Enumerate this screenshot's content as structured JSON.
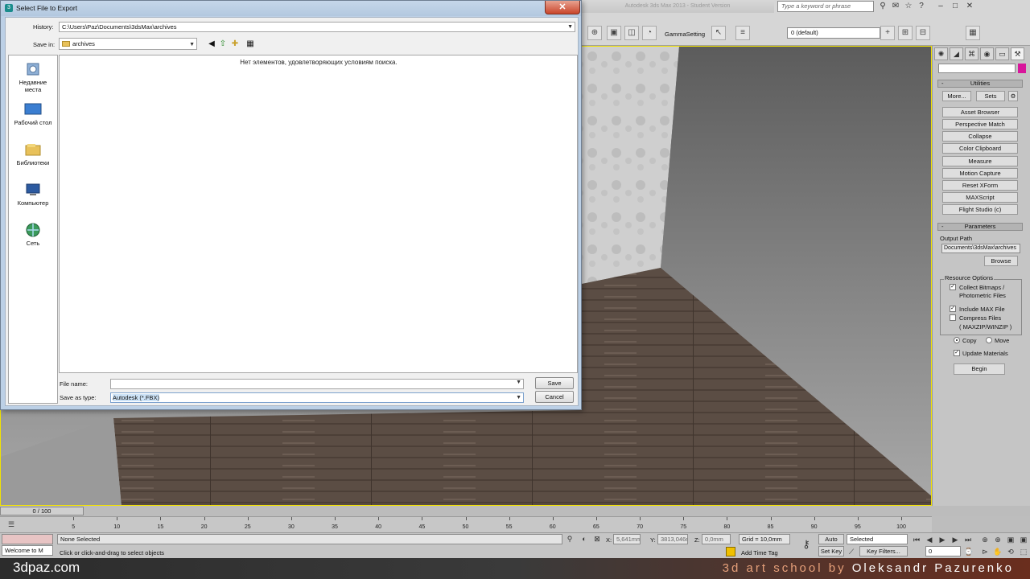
{
  "dialog": {
    "title": "Select File to Export",
    "close_label": "✕",
    "history_label": "History:",
    "history_value": "C:\\Users\\Paz\\Documents\\3dsMax\\archives",
    "save_in_label": "Save in:",
    "save_in_value": "archives",
    "empty_message": "Нет элементов, удовлетворяющих условиям поиска.",
    "places": [
      {
        "line1": "Недавние",
        "line2": "места"
      },
      {
        "line1": "Рабочий стол",
        "line2": ""
      },
      {
        "line1": "Библиотеки",
        "line2": ""
      },
      {
        "line1": "Компьютер",
        "line2": ""
      },
      {
        "line1": "Сеть",
        "line2": ""
      }
    ],
    "file_name_label": "File name:",
    "file_name_value": "",
    "save_as_type_label": "Save as type:",
    "save_as_type_value": "Autodesk (*.FBX)",
    "save_button": "Save",
    "cancel_button": "Cancel"
  },
  "topbar": {
    "app_title": "Autodesk 3ds Max 2013 - Student Version",
    "search_placeholder": "Type a keyword or phrase",
    "gamma_label": "GammaSetting",
    "layer_value": "0 (default)"
  },
  "command_panel": {
    "utilities_title": "Utilities",
    "more_button": "More...",
    "sets_button": "Sets",
    "utility_buttons": [
      "Asset Browser",
      "Perspective Match",
      "Collapse",
      "Color Clipboard",
      "Measure",
      "Motion Capture",
      "Reset XForm",
      "MAXScript",
      "Flight Studio (c)"
    ],
    "parameters_title": "Parameters",
    "output_path_label": "Output Path",
    "output_path_value": "Documents\\3dsMax\\archives",
    "browse_button": "Browse",
    "resource_options_label": "Resource Options",
    "collect_bitmaps_line1": "Collect Bitmaps /",
    "collect_bitmaps_line2": "Photometric Files",
    "include_max_label": "Include MAX File",
    "compress_files_label": "Compress Files",
    "compress_format": "( MAXZIP/WINZIP )",
    "copy_label": "Copy",
    "move_label": "Move",
    "update_materials_label": "Update Materials",
    "begin_button": "Begin",
    "sign": "-",
    "colors": {
      "swatch": "#d8169b"
    }
  },
  "timeline": {
    "frame_indicator": "0 / 100",
    "ticks": [
      "5",
      "10",
      "15",
      "20",
      "25",
      "30",
      "35",
      "40",
      "45",
      "50",
      "55",
      "60",
      "65",
      "70",
      "75",
      "80",
      "85",
      "90",
      "95",
      "100"
    ]
  },
  "status": {
    "selection": "None Selected",
    "hint": "Click or click-and-drag to select objects",
    "maxscript": "Welcome to M",
    "x_label": "X:",
    "x_value": "5,641mm",
    "y_label": "Y:",
    "y_value": "3813,046m",
    "z_label": "Z:",
    "z_value": "0,0mm",
    "grid": "Grid = 10,0mm",
    "add_time_tag": "Add Time Tag",
    "auto_key": "Auto Key",
    "set_key": "Set Key",
    "selected_dropdown": "Selected",
    "key_filters": "Key Filters...",
    "frame_value": "0"
  },
  "brand": {
    "site": "3dpaz.com",
    "school_prefix": "3d art school by",
    "author": "Oleksandr Pazurenko"
  }
}
